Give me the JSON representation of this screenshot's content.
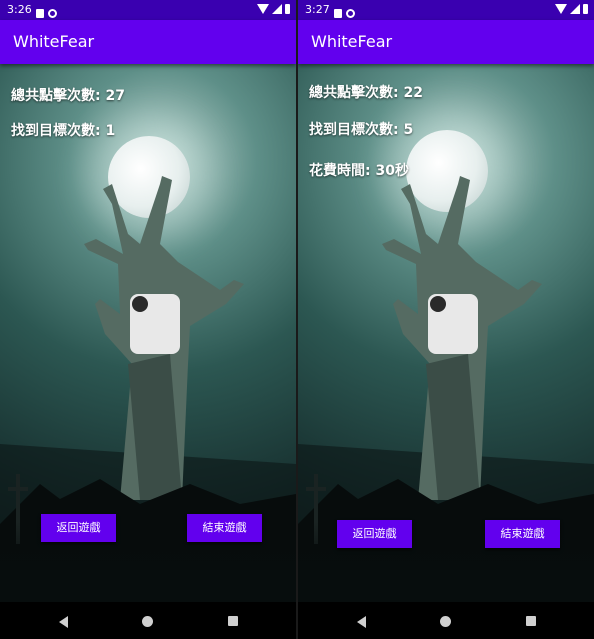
{
  "left": {
    "status_time": "3:26",
    "app_title": "WhiteFear",
    "stats": [
      "總共點擊次數: 27",
      "找到目標次數: 1"
    ],
    "back_button": "返回遊戲",
    "end_button": "結束遊戲"
  },
  "right": {
    "status_time": "3:27",
    "app_title": "WhiteFear",
    "stats": [
      "總共點擊次數: 22",
      "找到目標次數: 5",
      "花費時間: 30秒"
    ],
    "back_button": "返回遊戲",
    "end_button": "結束遊戲"
  },
  "colors": {
    "app_bar": "#6200ee",
    "status_bar": "#3a00b0",
    "button": "#6200ee"
  },
  "icons": {
    "status": [
      "notification-icon",
      "sync-icon",
      "wifi-icon",
      "signal-icon",
      "battery-icon"
    ],
    "nav": [
      "back-icon",
      "home-icon",
      "recents-icon"
    ]
  }
}
